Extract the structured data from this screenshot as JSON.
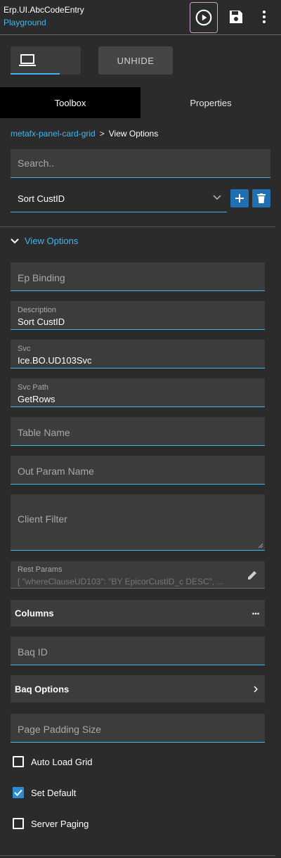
{
  "header": {
    "title": "Erp.UI.AbcCodeEntry",
    "subtitle": "Playground",
    "run_icon": "play-circle-icon",
    "save_icon": "save-icon",
    "more_icon": "more-vertical-icon"
  },
  "toolbar": {
    "device_icon": "laptop-icon",
    "unhide_label": "UNHIDE"
  },
  "tabs": [
    {
      "label": "Toolbox",
      "active": true
    },
    {
      "label": "Properties",
      "active": false
    }
  ],
  "breadcrumb": {
    "link": "metafx-panel-card-grid",
    "separator": ">",
    "current": "View Options"
  },
  "search": {
    "placeholder": "Search.."
  },
  "selector": {
    "value": "Sort CustID",
    "add_icon": "plus-icon",
    "delete_icon": "trash-icon"
  },
  "section": {
    "title": "View Options"
  },
  "fields": {
    "ep_binding": {
      "placeholder": "Ep Binding"
    },
    "description": {
      "label": "Description",
      "value": "Sort CustID"
    },
    "svc": {
      "label": "Svc",
      "value": "Ice.BO.UD103Svc"
    },
    "svc_path": {
      "label": "Svc Path",
      "value": "GetRows"
    },
    "table_name": {
      "placeholder": "Table Name"
    },
    "out_param_name": {
      "placeholder": "Out Param Name"
    },
    "client_filter": {
      "placeholder": "Client Filter"
    },
    "rest_params": {
      "label": "Rest Params",
      "value": "[ \"whereClauseUD103\": \"BY EpicorCustID_c DESC\", ..."
    },
    "baq_id": {
      "placeholder": "Baq ID"
    },
    "page_padding_size": {
      "placeholder": "Page Padding Size"
    }
  },
  "groups": {
    "columns": {
      "label": "Columns"
    },
    "baq_options": {
      "label": "Baq Options"
    }
  },
  "checkboxes": [
    {
      "label": "Auto Load Grid",
      "checked": false
    },
    {
      "label": "Set Default",
      "checked": true
    },
    {
      "label": "Server Paging",
      "checked": false
    }
  ],
  "colors": {
    "accent": "#3fb6f0",
    "background": "#2b2b2b",
    "field_bg": "#3c3c3c",
    "button_blue": "#1f6fb2"
  }
}
